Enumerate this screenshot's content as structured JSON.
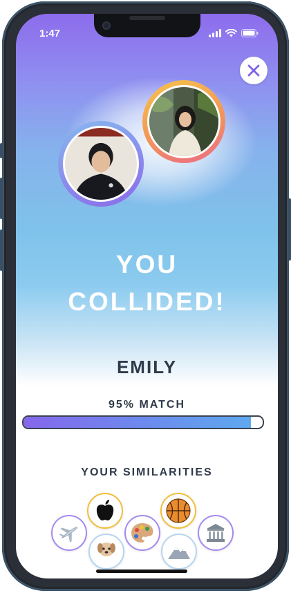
{
  "status": {
    "time": "1:47"
  },
  "headline": {
    "line1": "YOU",
    "line2": "COLLIDED!"
  },
  "match": {
    "name": "EMILY",
    "label": "95% MATCH",
    "percent": 95
  },
  "similarities": {
    "title": "YOUR SIMILARITIES",
    "icons": [
      "airplane-icon",
      "apple-icon",
      "dog-icon",
      "palette-icon",
      "basketball-icon",
      "mountain-icon",
      "museum-icon"
    ]
  },
  "colors": {
    "accent_purple": "#8667ec",
    "accent_blue": "#5ea9ef",
    "text_dark": "#2f3a4a"
  }
}
